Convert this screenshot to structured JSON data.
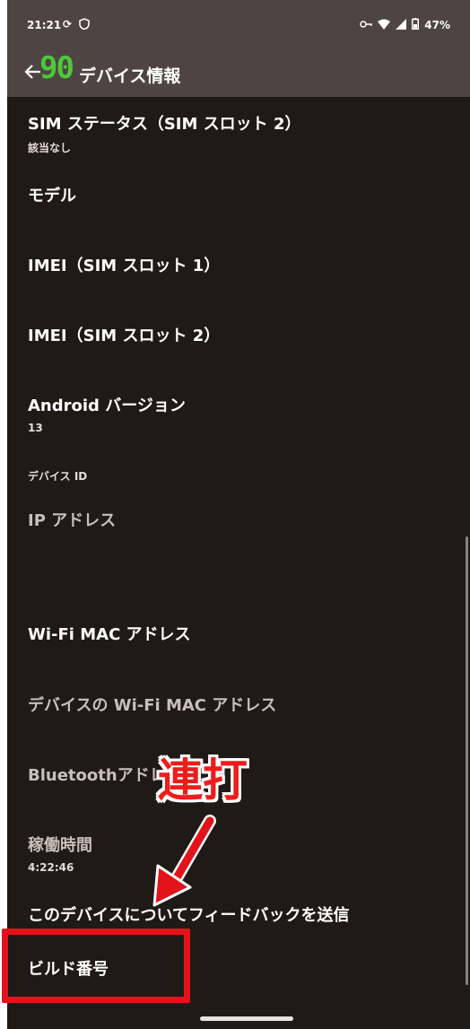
{
  "status_bar": {
    "time": "21:21",
    "battery": "47%",
    "icons": [
      "sync-icon",
      "shield-icon",
      "vpn-key-icon",
      "wifi-icon",
      "signal-icon",
      "battery-icon"
    ]
  },
  "app_bar": {
    "fps_overlay": "90",
    "title": "デバイス情報",
    "back_icon": "arrow-left-icon"
  },
  "items": [
    {
      "title": "SIM ステータス（SIM スロット 2）",
      "subtitle": "該当なし"
    },
    {
      "title": "モデル"
    },
    {
      "title": "IMEI（SIM スロット 1）"
    },
    {
      "title": "IMEI（SIM スロット 2）"
    },
    {
      "title": "Android バージョン",
      "subtitle": "13"
    },
    {
      "title": "デバイス ID"
    },
    {
      "title": "IP アドレス"
    },
    {
      "title": "Wi-Fi MAC アドレス"
    },
    {
      "title": "デバイスの Wi-Fi MAC アドレス"
    },
    {
      "title": "Bluetoothアドレ"
    },
    {
      "title": "稼働時間",
      "subtitle": "4:22:46"
    },
    {
      "title": "このデバイスについてフィードバックを送信"
    },
    {
      "title": "ビルド番号"
    }
  ],
  "annotation": {
    "text": "連打",
    "color": "#e3131b"
  },
  "colors": {
    "background": "#201a17",
    "app_bar": "#4e4542",
    "fps_overlay": "#4cc83a"
  }
}
